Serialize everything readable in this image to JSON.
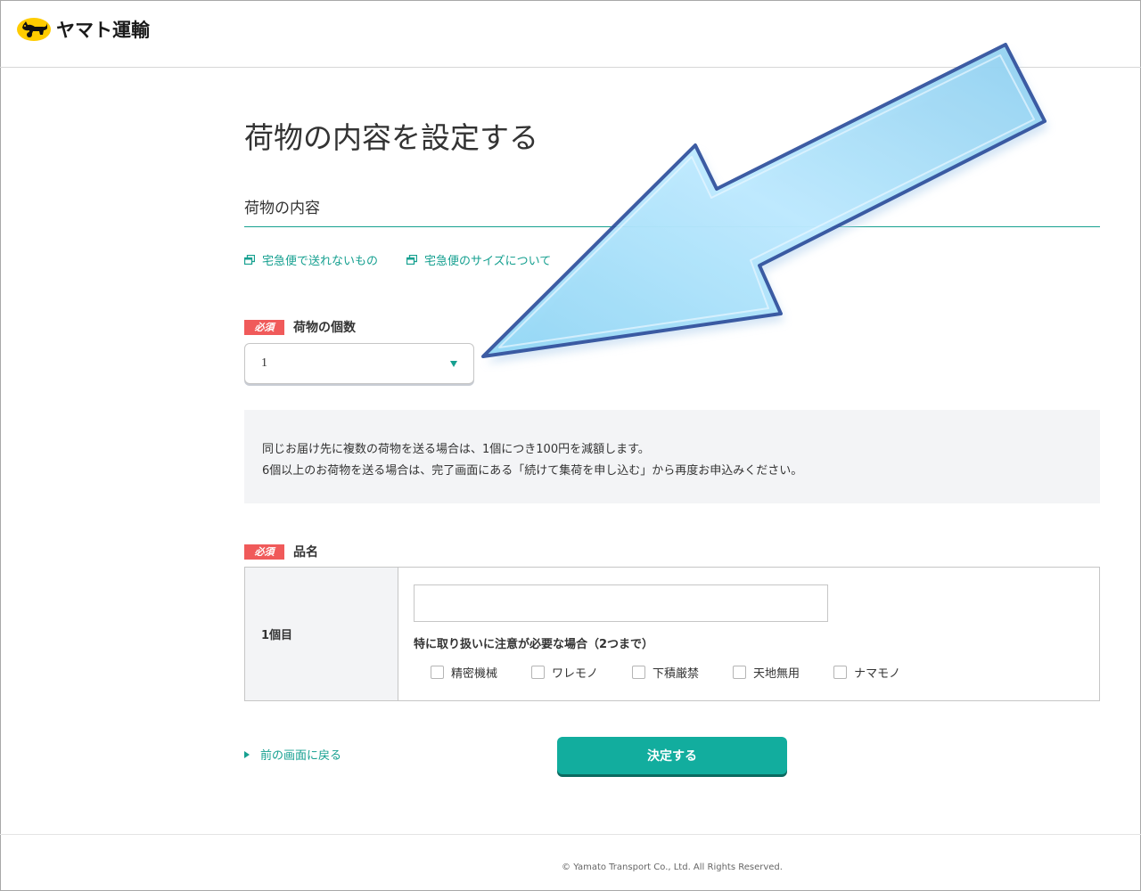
{
  "header": {
    "logo_text": "ヤマト運輸"
  },
  "page": {
    "title": "荷物の内容を設定する",
    "section_title": "荷物の内容"
  },
  "links": [
    {
      "label": "宅急便で送れないもの",
      "icon": "external-window-icon"
    },
    {
      "label": "宅急便のサイズについて",
      "icon": "external-window-icon"
    }
  ],
  "quantity": {
    "badge": "必須",
    "label": "荷物の個数",
    "selected_value": "1"
  },
  "notice": {
    "line1": "同じお届け先に複数の荷物を送る場合は、1個につき100円を減額します。",
    "line2": "6個以上のお荷物を送る場合は、完了画面にある「続けて集荷を申し込む」から再度お申込みください。"
  },
  "item_name": {
    "badge": "必須",
    "label": "品名",
    "row_header": "1個目",
    "input_value": "",
    "care_label": "特に取り扱いに注意が必要な場合（2つまで）",
    "options": [
      {
        "label": "精密機械",
        "checked": false
      },
      {
        "label": "ワレモノ",
        "checked": false
      },
      {
        "label": "下積厳禁",
        "checked": false
      },
      {
        "label": "天地無用",
        "checked": false
      },
      {
        "label": "ナマモノ",
        "checked": false
      }
    ]
  },
  "actions": {
    "back_label": "前の画面に戻る",
    "submit_label": "決定する"
  },
  "footer": {
    "copyright": "© Yamato Transport Co., Ltd. All Rights Reserved."
  },
  "colors": {
    "accent": "#16a090",
    "button": "#12ad9e",
    "required_badge": "#f05a5a",
    "logo_yellow": "#ffcc00"
  }
}
